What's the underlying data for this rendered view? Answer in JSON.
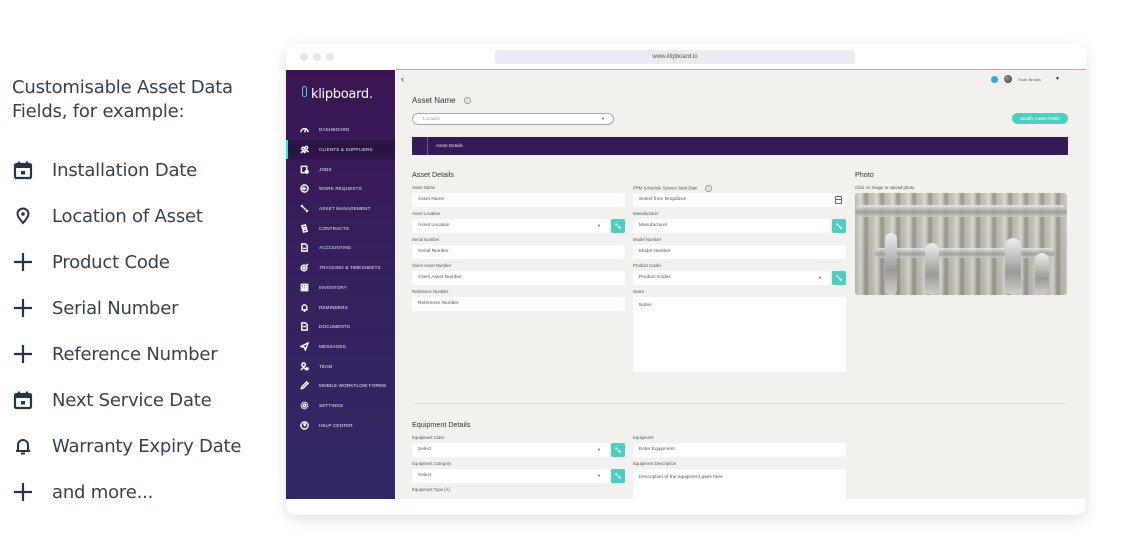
{
  "promo": {
    "heading": "Customisable Asset Data Fields, for example:",
    "items": [
      {
        "icon": "calendar-icon",
        "label": "Installation Date"
      },
      {
        "icon": "location-pin-icon",
        "label": "Location of Asset"
      },
      {
        "icon": "plus-icon",
        "label": "Product Code"
      },
      {
        "icon": "plus-icon",
        "label": "Serial Number"
      },
      {
        "icon": "plus-icon",
        "label": "Reference Number"
      },
      {
        "icon": "calendar-icon",
        "label": "Next Service Date"
      },
      {
        "icon": "bell-icon",
        "label": "Warranty Expiry Date"
      },
      {
        "icon": "plus-icon",
        "label": "and more..."
      }
    ]
  },
  "browser": {
    "url": "www.klipboard.io"
  },
  "app": {
    "logo": "klipboard.",
    "user": "Evan Brooks",
    "nav": [
      {
        "icon": "dashboard-icon",
        "label": "Dashboard",
        "active": false
      },
      {
        "icon": "clients-icon",
        "label": "Clients & Suppliers",
        "active": true
      },
      {
        "icon": "jobs-icon",
        "label": "Jobs",
        "active": false
      },
      {
        "icon": "work-requests-icon",
        "label": "Work Requests",
        "active": false
      },
      {
        "icon": "wrench-icon",
        "label": "Asset Management",
        "active": false
      },
      {
        "icon": "contracts-icon",
        "label": "Contracts",
        "active": false
      },
      {
        "icon": "document-icon",
        "label": "Accounting",
        "active": false
      },
      {
        "icon": "tracking-icon",
        "label": "Tracking & Timesheets",
        "active": false
      },
      {
        "icon": "inventory-icon",
        "label": "Inventory",
        "active": false
      },
      {
        "icon": "bell-icon",
        "label": "Reminders",
        "active": false
      },
      {
        "icon": "document-icon",
        "label": "Documents",
        "active": false
      },
      {
        "icon": "send-icon",
        "label": "Messages",
        "active": false
      },
      {
        "icon": "team-icon",
        "label": "Team",
        "active": false
      },
      {
        "icon": "pencil-icon",
        "label": "Mobile Workflow Forms",
        "active": false
      },
      {
        "icon": "gear-icon",
        "label": "Settings",
        "active": false
      },
      {
        "icon": "help-icon",
        "label": "Help Center",
        "active": false
      }
    ],
    "page": {
      "title": "Asset Name",
      "location_placeholder": "Location",
      "modify_button": "Modify Asset Fields",
      "section_tab": "Asset Details"
    },
    "asset_details": {
      "title": "Asset Details",
      "fields": [
        {
          "label": "Asset Name",
          "placeholder": "Asset Name"
        },
        {
          "label": "Asset Location",
          "placeholder": "Asset Location"
        },
        {
          "label": "Serial Number",
          "placeholder": "Serial Number"
        },
        {
          "label": "Client Asset Number",
          "placeholder": "Client Asset Number"
        },
        {
          "label": "Reference Number",
          "placeholder": "Reference Number"
        }
      ],
      "fields_right": [
        {
          "label": "PPM Schedule Service Start Date",
          "placeholder": "Select from Dropdown"
        },
        {
          "label": "Manufacturer",
          "placeholder": "Manufacturer"
        },
        {
          "label": "Model Number",
          "placeholder": "Model Number"
        },
        {
          "label": "Product Codes",
          "placeholder": "Product Codes"
        },
        {
          "label": "Notes",
          "placeholder": "Notes"
        }
      ]
    },
    "photo": {
      "title": "Photo",
      "hint": "Click on Image to upload photo"
    },
    "equipment_details": {
      "title": "Equipment Details",
      "fields_left": [
        {
          "label": "Equipment Class",
          "placeholder": "Select"
        },
        {
          "label": "Equipment Category",
          "placeholder": "Select"
        },
        {
          "label": "Equipment Type (A)",
          "placeholder": ""
        }
      ],
      "fields_right": [
        {
          "label": "Equipment",
          "placeholder": "Enter Equipment"
        },
        {
          "label": "Equipment Description",
          "placeholder": "Description of the equipment goes here"
        }
      ]
    }
  }
}
